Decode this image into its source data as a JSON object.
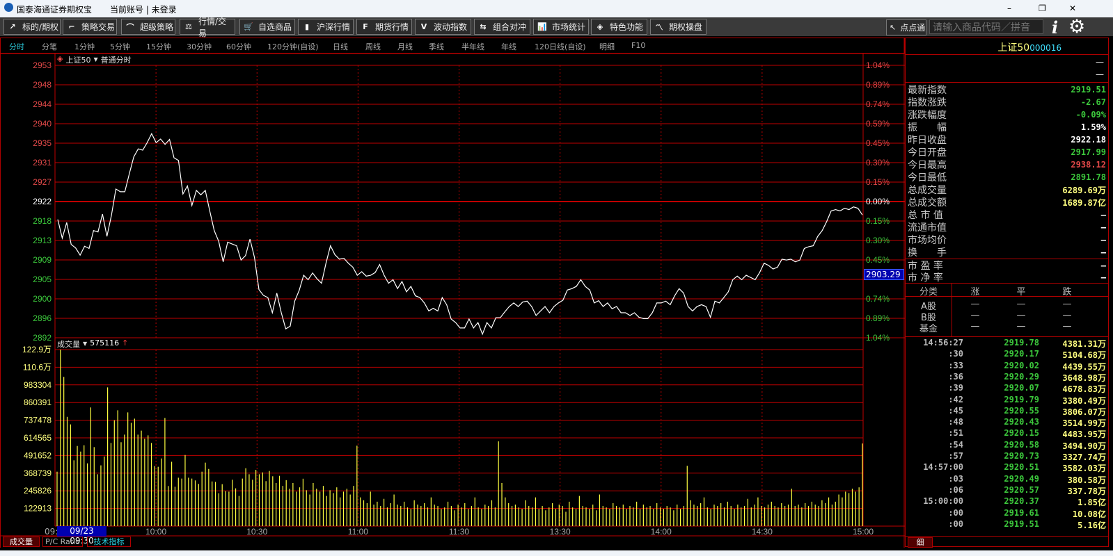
{
  "window": {
    "title": "国泰海通证券期权宝",
    "account": "当前账号 | 未登录",
    "minimize": "–",
    "restore": "❐",
    "close": "✕"
  },
  "toolbar": {
    "buttons": [
      {
        "label": "标的/期权",
        "icon": "trend-icon",
        "glyph": "↗"
      },
      {
        "label": "策略交易",
        "icon": "strategy-icon",
        "glyph": "⌐"
      },
      {
        "label": "超级策略",
        "icon": "curve-icon",
        "glyph": "⌒"
      },
      {
        "label": "行情/交易",
        "icon": "scale-icon",
        "glyph": "⚖"
      },
      {
        "label": "自选商品",
        "icon": "cart-icon",
        "glyph": "🛒"
      },
      {
        "label": "沪深行情",
        "icon": "bars-icon",
        "glyph": "▮"
      },
      {
        "label": "期货行情",
        "icon": "f-icon",
        "glyph": "F"
      },
      {
        "label": "波动指数",
        "icon": "v-icon",
        "glyph": "V"
      },
      {
        "label": "组合对冲",
        "icon": "hedge-icon",
        "glyph": "⇆"
      },
      {
        "label": "市场统计",
        "icon": "stats-icon",
        "glyph": "📊"
      },
      {
        "label": "特色功能",
        "icon": "cube-icon",
        "glyph": "◈"
      },
      {
        "label": "期权操盘",
        "icon": "chart-icon",
        "glyph": "〽"
      }
    ],
    "dian": "点点通",
    "search_placeholder": "请输入商品代码／拼音",
    "info": "i",
    "gear": "⚙"
  },
  "tabs": [
    "分时",
    "分笔",
    "1分钟",
    "5分钟",
    "15分钟",
    "30分钟",
    "60分钟",
    "120分钟(自设)",
    "日线",
    "周线",
    "月线",
    "季线",
    "半年线",
    "年线",
    "120日线(自设)",
    "明细",
    "F10"
  ],
  "chart_header": {
    "symbol": "上证50",
    "mode": "普通分时"
  },
  "volume_header": {
    "label": "成交量",
    "value": "575116",
    "arrow": "↑"
  },
  "crosshair_label": "2903.29",
  "date_label": "09/23 09:30",
  "time_first": "09:",
  "bottom_tabs": [
    "成交量",
    "P/C Ratio",
    "技术指标"
  ],
  "chart_data": [
    {
      "type": "line",
      "title": "上证50 普通分时",
      "ylim": [
        2892,
        2953
      ],
      "prev_close": 2922.18,
      "y_ticks": [
        "2953",
        "2948",
        "2944",
        "2940",
        "2935",
        "2931",
        "2927",
        "2922",
        "2918",
        "2913",
        "2909",
        "2905",
        "2900",
        "2896",
        "2892"
      ],
      "pct_ticks": [
        "1.04%",
        "0.89%",
        "0.74%",
        "0.59%",
        "0.45%",
        "0.30%",
        "0.15%",
        "0.00%",
        "0.15%",
        "0.30%",
        "0.45%",
        "0.59%",
        "0.74%",
        "0.89%",
        "1.04%"
      ],
      "x_ticks": [
        {
          "label": "10:00",
          "minute": 30
        },
        {
          "label": "10:30",
          "minute": 60
        },
        {
          "label": "11:00",
          "minute": 90
        },
        {
          "label": "11:30",
          "minute": 120
        },
        {
          "label": "13:30",
          "minute": 150
        },
        {
          "label": "14:00",
          "minute": 180
        },
        {
          "label": "14:30",
          "minute": 210
        },
        {
          "label": "15:00",
          "minute": 240
        }
      ],
      "price": [
        2918.5,
        2914.3,
        2917.8,
        2912.9,
        2912.1,
        2910.5,
        2912.5,
        2912,
        2916,
        2915.7,
        2919.7,
        2914.7,
        2919.4,
        2925.3,
        2924.7,
        2924.7,
        2928.7,
        2932.5,
        2934.3,
        2934,
        2935.7,
        2937.7,
        2935.7,
        2936.5,
        2935.3,
        2936.4,
        2932.3,
        2931.7,
        2924.2,
        2926,
        2921.6,
        2925,
        2924,
        2925,
        2920.4,
        2916,
        2913.6,
        2909,
        2913.4,
        2913,
        2912.6,
        2909.4,
        2910.4,
        2914.1,
        2910,
        2902.8,
        2901.5,
        2901,
        2897.6,
        2902,
        2897.6,
        2894,
        2894.6,
        2900.2,
        2902.6,
        2906,
        2905,
        2906.5,
        2905.2,
        2904.2,
        2908.7,
        2912.6,
        2910.6,
        2909.6,
        2909.8,
        2908.7,
        2907.8,
        2906,
        2906.8,
        2905.8,
        2906,
        2906.6,
        2908.4,
        2906,
        2904.2,
        2905,
        2903,
        2904.6,
        2902.3,
        2903.5,
        2901.4,
        2901,
        2899.8,
        2898,
        2898.6,
        2898,
        2901,
        2899.4,
        2896.2,
        2895.4,
        2894.2,
        2894.2,
        2896.2,
        2894.2,
        2895.4,
        2892.8,
        2895.4,
        2894.2,
        2896.5,
        2896.5,
        2897.8,
        2899,
        2899.8,
        2899,
        2900,
        2900.2,
        2899,
        2897,
        2898,
        2899,
        2897.6,
        2899,
        2899.8,
        2900.4,
        2902.7,
        2903,
        2903.5,
        2905,
        2903.5,
        2902.7,
        2899.8,
        2900.3,
        2899,
        2899.8,
        2898.5,
        2899,
        2897.6,
        2897.6,
        2897,
        2897.6,
        2896.6,
        2896.3,
        2896.3,
        2897.6,
        2899.8,
        2899.8,
        2900.2,
        2899.4,
        2901.4,
        2903,
        2902,
        2899,
        2898,
        2899,
        2899.4,
        2899,
        2896.6,
        2900.2,
        2899.8,
        2901,
        2902.3,
        2905,
        2905.8,
        2905,
        2906,
        2905.5,
        2905,
        2906.6,
        2908.7,
        2908.2,
        2907.4,
        2907.8,
        2909.6,
        2909.4,
        2909.6,
        2909,
        2909.4,
        2912,
        2912.4,
        2912.6,
        2914.7,
        2916,
        2918,
        2920.4,
        2920.7,
        2920.4,
        2921,
        2920.7,
        2921.3,
        2921,
        2919.5
      ]
    },
    {
      "type": "bar",
      "title": "成交量",
      "ylim": [
        0,
        1229000
      ],
      "unit": "thousand shares",
      "y_ticks": [
        "122.9万",
        "110.6万",
        "983304",
        "860391",
        "737478",
        "614565",
        "491652",
        "368739",
        "245826",
        "122913"
      ],
      "volume_thousands": [
        379,
        1229,
        1039,
        761,
        708,
        458,
        558,
        519,
        563,
        437,
        826,
        550,
        361,
        423,
        485,
        966,
        579,
        737,
        806,
        584,
        637,
        792,
        719,
        748,
        637,
        665,
        608,
        632,
        579,
        418,
        413,
        471,
        753,
        279,
        448,
        274,
        337,
        331,
        495,
        337,
        331,
        318,
        294,
        379,
        442,
        398,
        311,
        308,
        229,
        292,
        244,
        240,
        323,
        263,
        210,
        331,
        403,
        361,
        323,
        392,
        361,
        374,
        313,
        384,
        347,
        300,
        350,
        280,
        320,
        260,
        300,
        240,
        270,
        330,
        250,
        220,
        300,
        260,
        240,
        280,
        210,
        250,
        230,
        270,
        200,
        240,
        260,
        220,
        280,
        560,
        200,
        180,
        160,
        240,
        150,
        170,
        140,
        190,
        130,
        160,
        220,
        150,
        140,
        170,
        130,
        120,
        180,
        150,
        140,
        160,
        130,
        200,
        150,
        140,
        120,
        130,
        170,
        140,
        110,
        150,
        130,
        160,
        120,
        140,
        200,
        130,
        120,
        150,
        140,
        180,
        130,
        590,
        300,
        200,
        160,
        140,
        150,
        130,
        120,
        180,
        140,
        130,
        200,
        120,
        140,
        110,
        130,
        160,
        120,
        150,
        140,
        100,
        170,
        130,
        120,
        210,
        140,
        130,
        120,
        150,
        110,
        220,
        140,
        130,
        120,
        160,
        140,
        130,
        150,
        120,
        140,
        130,
        170,
        120,
        150,
        130,
        140,
        120,
        160,
        130,
        120,
        140,
        130,
        110,
        150,
        120,
        140,
        420,
        180,
        150,
        140,
        160,
        200,
        130,
        120,
        150,
        140,
        160,
        130,
        170,
        140,
        120,
        150,
        130,
        140,
        190,
        130,
        150,
        200,
        140,
        130,
        150,
        170,
        140,
        130,
        160,
        140,
        150,
        260,
        140,
        150,
        130,
        160,
        140,
        170,
        150,
        140,
        180,
        160,
        200,
        150,
        170,
        220,
        200,
        240,
        230,
        260,
        240,
        270,
        575.116
      ]
    }
  ],
  "quote": {
    "name": "上证50",
    "code": "000016",
    "top_dash": "—",
    "rows": [
      {
        "label": "最新指数",
        "value": "2919.51",
        "color": "#3cc83c"
      },
      {
        "label": "指数涨跌",
        "value": "-2.67",
        "color": "#3cc83c"
      },
      {
        "label": "涨跌幅度",
        "value": "-0.09%",
        "color": "#3cc83c"
      },
      {
        "label": "振　　幅",
        "value": "1.59%",
        "color": "#ffffff"
      },
      {
        "label": "昨日收盘",
        "value": "2922.18",
        "color": "#ffffff"
      },
      {
        "label": "今日开盘",
        "value": "2917.99",
        "color": "#3cc83c"
      },
      {
        "label": "今日最高",
        "value": "2938.12",
        "color": "#e04848"
      },
      {
        "label": "今日最低",
        "value": "2891.78",
        "color": "#3cc83c"
      },
      {
        "label": "总成交量",
        "value": "6289.69万",
        "color": "#ffff80"
      },
      {
        "label": "总成交额",
        "value": "1689.87亿",
        "color": "#ffff80"
      },
      {
        "label": "总 市 值",
        "value": "—",
        "color": "#ffffff"
      },
      {
        "label": "流通市值",
        "value": "—",
        "color": "#ffffff"
      },
      {
        "label": "市场均价",
        "value": "—",
        "color": "#ffffff"
      },
      {
        "label": "换　　手",
        "value": "—",
        "color": "#ffffff"
      }
    ],
    "ratios": [
      {
        "label": "市 盈 率",
        "value": "—"
      },
      {
        "label": "市 净 率",
        "value": "—"
      }
    ],
    "breadth_header": [
      "分类",
      "涨",
      "平",
      "跌"
    ],
    "breadth": [
      {
        "cat": "A股",
        "up": "—",
        "flat": "—",
        "down": "—"
      },
      {
        "cat": "B股",
        "up": "—",
        "flat": "—",
        "down": "—"
      },
      {
        "cat": "基金",
        "up": "—",
        "flat": "—",
        "down": "—"
      }
    ]
  },
  "ticks": [
    [
      "14:56:27",
      "2919.78",
      "4381.31万"
    ],
    [
      ":30",
      "2920.17",
      "5104.68万"
    ],
    [
      ":33",
      "2920.02",
      "4439.55万"
    ],
    [
      ":36",
      "2920.29",
      "3648.98万"
    ],
    [
      ":39",
      "2920.07",
      "4678.83万"
    ],
    [
      ":42",
      "2919.79",
      "3380.49万"
    ],
    [
      ":45",
      "2920.55",
      "3806.07万"
    ],
    [
      ":48",
      "2920.43",
      "3514.99万"
    ],
    [
      ":51",
      "2920.15",
      "4483.95万"
    ],
    [
      ":54",
      "2920.58",
      "3494.90万"
    ],
    [
      ":57",
      "2920.73",
      "3327.74万"
    ],
    [
      "14:57:00",
      "2920.51",
      "3582.03万"
    ],
    [
      ":03",
      "2920.49",
      "380.58万"
    ],
    [
      ":06",
      "2920.57",
      "337.78万"
    ],
    [
      "15:00:00",
      "2920.37",
      "1.85亿"
    ],
    [
      ":00",
      "2919.61",
      "10.08亿"
    ],
    [
      ":00",
      "2919.51",
      "5.16亿"
    ]
  ],
  "ticks_tab": "细",
  "colors": {
    "grid": "#c00000",
    "up": "#e04848",
    "down": "#3cc83c",
    "volume": "#ffff40",
    "line": "#ffffff",
    "accent": "#2bc6d6"
  }
}
